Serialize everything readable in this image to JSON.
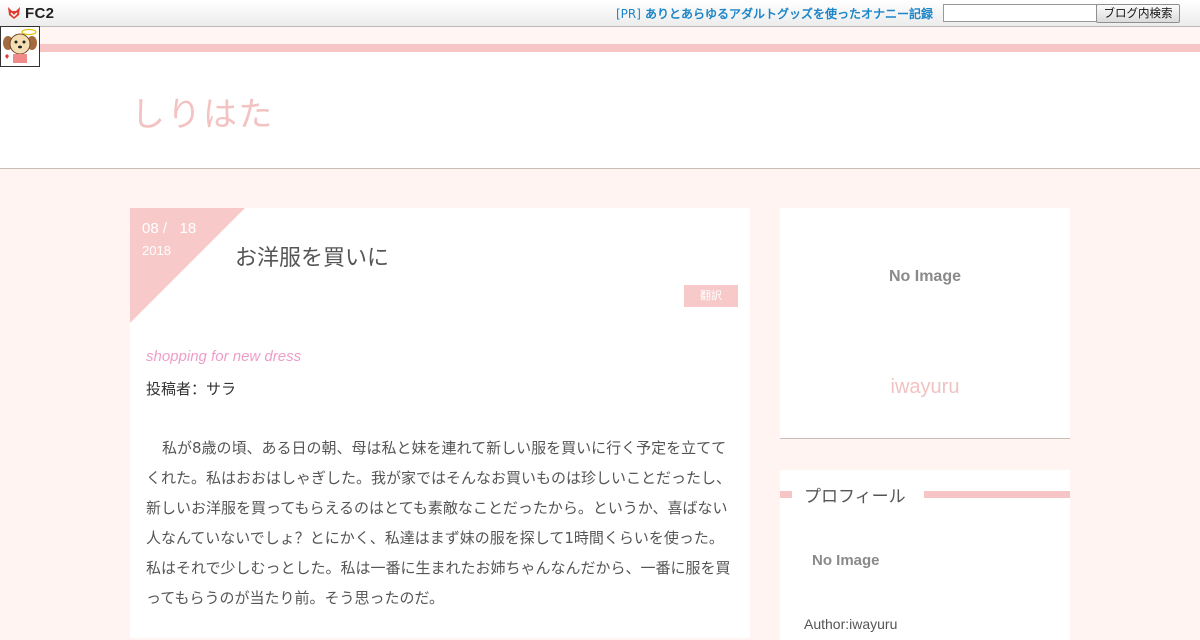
{
  "fc2bar": {
    "logo_text": "FC2",
    "pr_tag": "[PR]",
    "pr_text": "ありとあらゆるアダルトグッズを使ったオナニー記録",
    "search_placeholder": "",
    "search_button": "ブログ内検索"
  },
  "header": {
    "site_title": "しりはた"
  },
  "article": {
    "date_month_day": "08 /   18",
    "date_year": "2018",
    "title": "お洋服を買いに",
    "translate_label": "翻訳",
    "subtitle": "shopping for new dress",
    "author_line": "投稿者：サラ",
    "body": "私が8歳の頃、ある日の朝、母は私と妹を連れて新しい服を買いに行く予定を立ててくれた。私はおおはしゃぎした。我が家ではそんなお買いものは珍しいことだったし、新しいお洋服を買ってもらえるのはとても素敵なことだったから。というか、喜ばない人なんていないでしょ？とにかく、私達はまず妹の服を探して1時間くらいを使った。私はそれで少しむっとした。私は一番に生まれたお姉ちゃんなんだから、一番に服を買ってもらうのが当たり前。そう思ったのだ。"
  },
  "sidebar": {
    "card_image_text": "No Image",
    "card_author": "iwayuru",
    "profile_heading": "プロフィール",
    "profile_image_text": "No Image",
    "profile_author": "Author:iwayuru"
  },
  "colors": {
    "accent_pink": "#f7c5c5",
    "title_pink": "#f3c3c3",
    "subtitle_pink": "#ee9dc9",
    "link_blue": "#1d86c9",
    "page_bg": "#fff4f1"
  }
}
